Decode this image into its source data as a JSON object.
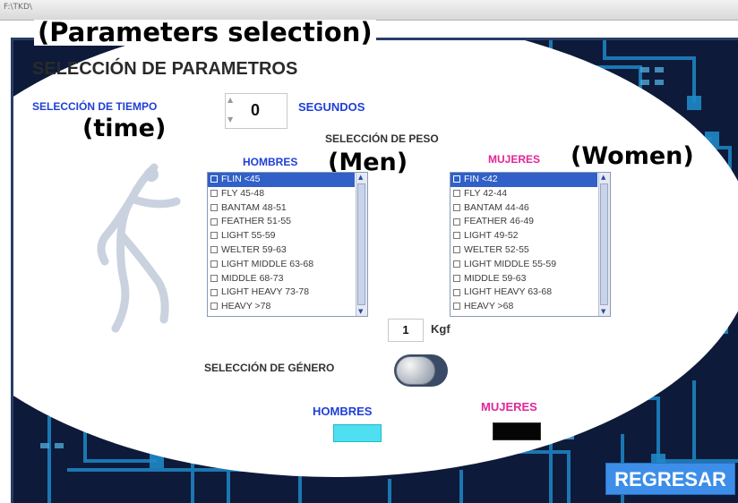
{
  "window": {
    "title": "F:\\TKD\\"
  },
  "annotations": {
    "params": "(Parameters selection)",
    "time": "(time)",
    "men": "(Men)",
    "women": "(Women)"
  },
  "heading": "SELECCIÓN DE PARAMETROS",
  "time": {
    "label": "SELECCIÓN DE TIEMPO",
    "value": "0",
    "unit": "SEGUNDOS"
  },
  "weight": {
    "label": "SELECCIÓN DE PESO"
  },
  "men": {
    "label": "HOMBRES",
    "items": [
      "FLIN <45",
      "FLY 45-48",
      "BANTAM 48-51",
      "FEATHER 51-55",
      "LIGHT 55-59",
      "WELTER 59-63",
      "LIGHT MIDDLE 63-68",
      "MIDDLE 68-73",
      "LIGHT HEAVY 73-78",
      "HEAVY >78"
    ],
    "selected_index": 0
  },
  "women": {
    "label": "MUJERES",
    "items": [
      "FIN <42",
      "FLY 42-44",
      "BANTAM 44-46",
      "FEATHER 46-49",
      "LIGHT 49-52",
      "WELTER 52-55",
      "LIGHT MIDDLE 55-59",
      "MIDDLE 59-63",
      "LIGHT HEAVY 63-68",
      "HEAVY >68"
    ],
    "selected_index": 0
  },
  "kgf": {
    "value": "1",
    "unit": "Kgf"
  },
  "gender": {
    "label": "SELECCIÓN DE GÉNERO",
    "men_label": "HOMBRES",
    "women_label": "MUJERES",
    "men_indicator_color": "#4ee0f0",
    "women_indicator_color": "#050505"
  },
  "back_button": "REGRESAR",
  "colors": {
    "accent_blue": "#1f3fd8",
    "accent_pink": "#e0269a",
    "background": "#0d1a3a",
    "button": "#3d8ee8"
  }
}
